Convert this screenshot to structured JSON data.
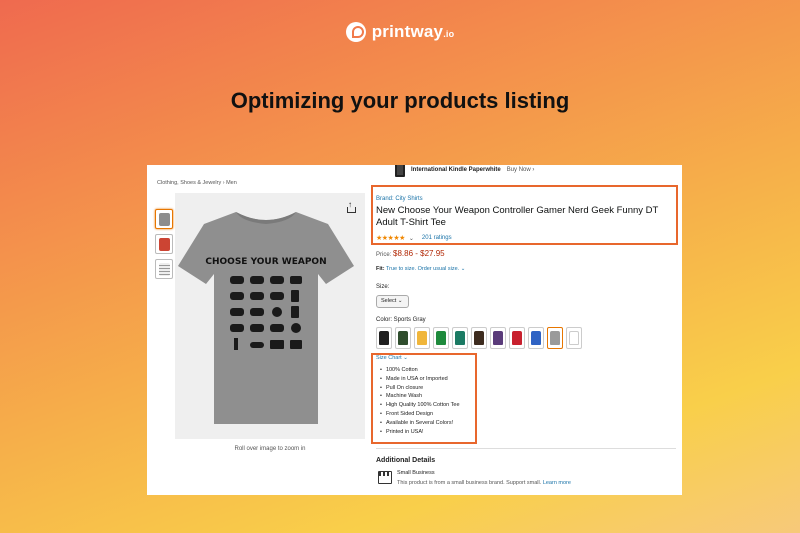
{
  "brand": {
    "name": "printway",
    "tld": ".io"
  },
  "headline": "Optimizing your products listing",
  "listing": {
    "kindle": {
      "title": "International Kindle Paperwhite",
      "buy": "Buy Now ›"
    },
    "breadcrumb": "Clothing, Shoes & Jewelry › Men",
    "zoom_hint": "Roll over image to zoom in",
    "shirt_text": "CHOOSE YOUR WEAPON",
    "brand_link": "Brand: City Shirts",
    "title": "New Choose Your Weapon Controller Gamer Nerd Geek Funny DT Adult T-Shirt Tee",
    "stars": "★★★★★",
    "rating_count": "201 ratings",
    "price_label": "Price:",
    "price": "$8.86 - $27.95",
    "fit_label": "Fit:",
    "fit_value": "True to size. Order usual size.",
    "size_label": "Size:",
    "size_select": "Select",
    "color_label": "Color: Sports Gray",
    "colors": [
      "#1f1f1f",
      "#2f4d2d",
      "#f0b63b",
      "#1e8a3c",
      "#1b7a63",
      "#3d2b1e",
      "#5a3b7a",
      "#c8202e",
      "#2f63c4",
      "#9a9a9a",
      "#ffffff"
    ],
    "size_chart": "Size Chart",
    "bullets": [
      "100% Cotton",
      "Made in USA or Imported",
      "Pull On closure",
      "Machine Wash",
      "High Quality 100% Cotton Tee",
      "Front Sided Design",
      "Available in Several Colors!",
      "Printed in USA!"
    ],
    "additional_details": "Additional Details",
    "small_business": "Small Business",
    "small_business_desc": "This product is from a small business brand. Support small.",
    "learn_more": "Learn more"
  },
  "colors": {
    "highlight": "#e8672d",
    "link": "#1a73a8",
    "price": "#b12704",
    "shirt": "#8f8f8f"
  }
}
